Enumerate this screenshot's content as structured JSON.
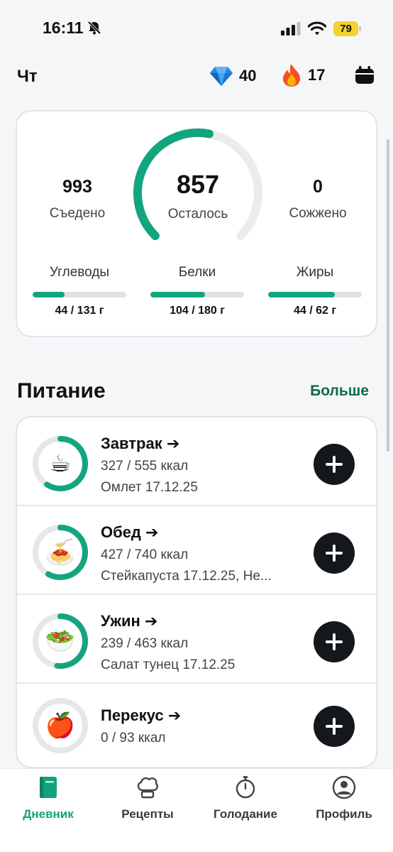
{
  "status_bar": {
    "time": "16:11",
    "battery": "79"
  },
  "header": {
    "day": "Чт",
    "gems": "40",
    "streak": "17"
  },
  "summary": {
    "eaten": {
      "value": "993",
      "label": "Съедено"
    },
    "remaining": {
      "value": "857",
      "label": "Осталось"
    },
    "burned": {
      "value": "0",
      "label": "Сожжено"
    },
    "ring_progress": 0.54,
    "macros": [
      {
        "label": "Углеводы",
        "value": "44 / 131 г",
        "progress": 0.34
      },
      {
        "label": "Белки",
        "value": "104 / 180 г",
        "progress": 0.58
      },
      {
        "label": "Жиры",
        "value": "44 / 62 г",
        "progress": 0.71
      }
    ]
  },
  "nutrition": {
    "title": "Питание",
    "more": "Больше",
    "meals": [
      {
        "title": "Завтрак ➔",
        "calories": "327 / 555 ккал",
        "description": "Омлет 17.12.25",
        "progress": 0.59,
        "icon": "coffee-icon",
        "emoji": "☕"
      },
      {
        "title": "Обед ➔",
        "calories": "427 / 740 ккал",
        "description": "Стейкапуста 17.12.25, Не...",
        "progress": 0.58,
        "icon": "noodle-bowl-icon",
        "emoji": "🍝"
      },
      {
        "title": "Ужин ➔",
        "calories": "239 / 463 ккал",
        "description": "Салат тунец 17.12.25",
        "progress": 0.52,
        "icon": "salad-icon",
        "emoji": "🥗"
      },
      {
        "title": "Перекус ➔",
        "calories": "0 / 93 ккал",
        "description": "",
        "progress": 0,
        "icon": "apple-icon",
        "emoji": "🍎"
      }
    ]
  },
  "nav": [
    {
      "label": "Дневник",
      "icon": "book-icon",
      "active": true
    },
    {
      "label": "Рецепты",
      "icon": "chef-hat-icon",
      "active": false
    },
    {
      "label": "Голодание",
      "icon": "stopwatch-icon",
      "active": false
    },
    {
      "label": "Профиль",
      "icon": "profile-icon",
      "active": false
    }
  ],
  "colors": {
    "accent": "#13a57e",
    "track": "#e6e7e9",
    "dark": "#14171c",
    "link": "#0f6b47"
  }
}
